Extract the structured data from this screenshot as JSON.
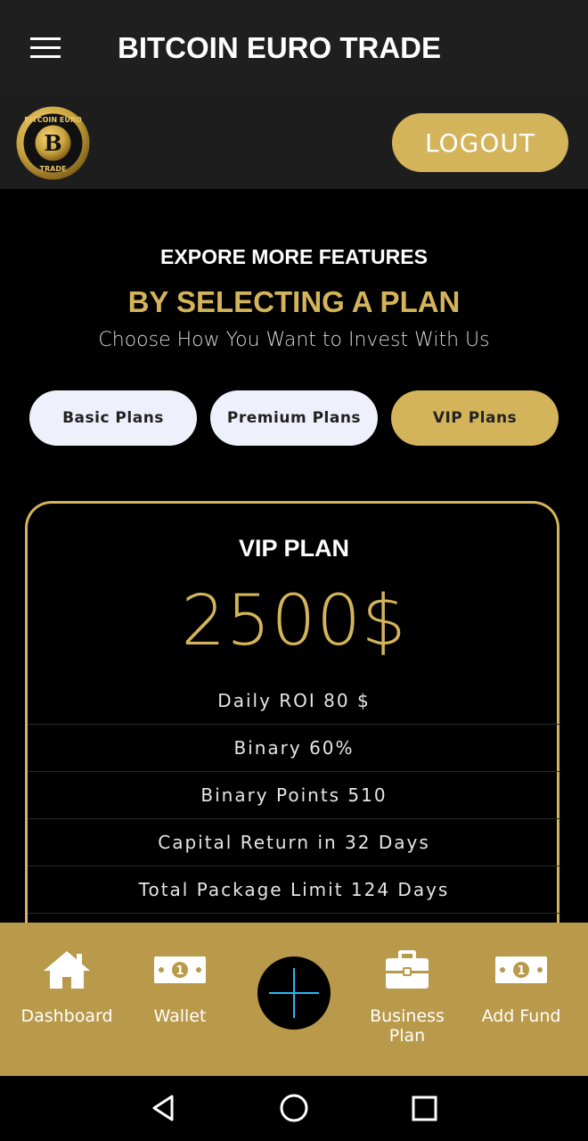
{
  "app": {
    "title": "BITCOIN EURO TRADE"
  },
  "header": {
    "logout_label": "LOGOUT",
    "logo_text_top": "BITCOIN EURO",
    "logo_text_bottom": "TRADE",
    "logo_letter": "B"
  },
  "intro": {
    "title": "EXPORE MORE FEATURES",
    "subtitle": "BY SELECTING A PLAN",
    "description": "Choose How You Want to Invest With Us"
  },
  "tabs": [
    {
      "label": "Basic Plans"
    },
    {
      "label": "Premium Plans"
    },
    {
      "label": "VIP Plans"
    }
  ],
  "plan": {
    "name": "VIP PLAN",
    "price": "2500$",
    "features": [
      "Daily ROI 80 $",
      "Binary 60%",
      "Binary Points 510",
      "Capital Return in 32 Days",
      "Total Package Limit 124 Days"
    ]
  },
  "nav": {
    "dashboard": "Dashboard",
    "wallet": "Wallet",
    "business_line1": "Business",
    "business_line2": "Plan",
    "add_fund": "Add Fund"
  },
  "colors": {
    "accent": "#d4b45a",
    "nav_bg": "#b99a4a",
    "tab_bg": "#eef0fb",
    "fab_plus": "#29b6f6"
  },
  "icons": [
    "menu-icon",
    "home-icon",
    "cash-icon",
    "briefcase-icon",
    "cash-icon",
    "plus-icon",
    "back-icon",
    "home-circle-icon",
    "recents-icon"
  ]
}
